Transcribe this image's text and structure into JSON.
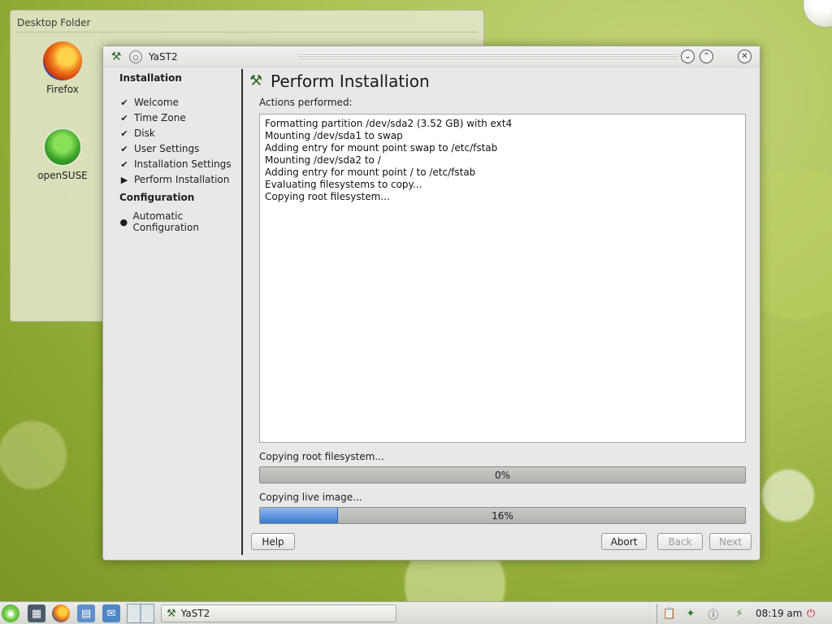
{
  "desktop": {
    "folder_title": "Desktop Folder",
    "icons": [
      {
        "label": "Firefox",
        "icon": "firefox-icon"
      },
      {
        "label": "openSUSE",
        "icon": "opensuse-icon"
      }
    ]
  },
  "window": {
    "title": "YaST2",
    "icons": {
      "app": "yast-icon",
      "menu": "window-menu-icon",
      "minimize": "chevron-down-icon",
      "maximize": "chevron-up-icon",
      "close": "close-icon"
    }
  },
  "sidebar": {
    "section1_title": "Installation",
    "steps": [
      {
        "label": "Welcome",
        "status": "done"
      },
      {
        "label": "Time Zone",
        "status": "done"
      },
      {
        "label": "Disk",
        "status": "done"
      },
      {
        "label": "User Settings",
        "status": "done"
      },
      {
        "label": "Installation Settings",
        "status": "done"
      },
      {
        "label": "Perform Installation",
        "status": "current"
      }
    ],
    "section2_title": "Configuration",
    "config_steps": [
      {
        "label": "Automatic Configuration",
        "status": "pending"
      }
    ]
  },
  "main": {
    "title": "Perform Installation",
    "log_label": "Actions performed:",
    "log_lines": [
      "Formatting partition /dev/sda2 (3.52 GB) with ext4",
      "Mounting /dev/sda1 to swap",
      "Adding entry for mount point swap to /etc/fstab",
      "Mounting /dev/sda2 to /",
      "Adding entry for mount point / to /etc/fstab",
      "Evaluating filesystems to copy...",
      "Copying root filesystem..."
    ],
    "progress1": {
      "label": "Copying root filesystem...",
      "percent_text": "0%",
      "value": 0
    },
    "progress2": {
      "label": "Copying live image...",
      "percent_text": "16%",
      "value": 16
    }
  },
  "buttons": {
    "help": "Help",
    "abort": "Abort",
    "back": "Back",
    "next": "Next"
  },
  "taskbar": {
    "task_label": "YaST2",
    "clock": "08:19 am"
  },
  "colors": {
    "progress_fill": "#3d79cc",
    "accent_green": "#2a6a2a"
  }
}
